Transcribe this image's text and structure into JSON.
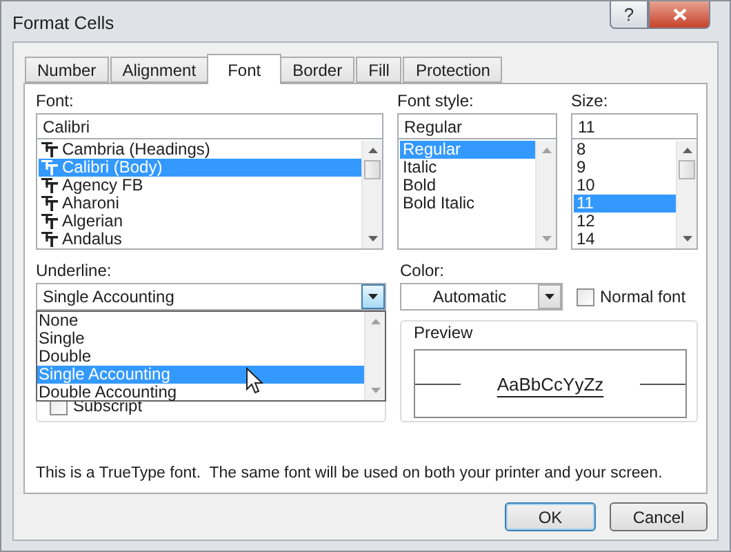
{
  "window": {
    "title": "Format Cells"
  },
  "title_buttons": [
    {
      "kind": "help",
      "label": "?"
    },
    {
      "kind": "close"
    }
  ],
  "tabs": [
    {
      "label": "Number",
      "selected": false
    },
    {
      "label": "Alignment",
      "selected": false
    },
    {
      "label": "Font",
      "selected": true
    },
    {
      "label": "Border",
      "selected": false
    },
    {
      "label": "Fill",
      "selected": false
    },
    {
      "label": "Protection",
      "selected": false
    }
  ],
  "font": {
    "label": "Font:",
    "value": "Calibri",
    "items": [
      {
        "name": "Cambria (Headings)",
        "selected": false
      },
      {
        "name": "Calibri (Body)",
        "selected": true
      },
      {
        "name": "Agency FB",
        "selected": false
      },
      {
        "name": "Aharoni",
        "selected": false
      },
      {
        "name": "Algerian",
        "selected": false
      },
      {
        "name": "Andalus",
        "selected": false
      }
    ]
  },
  "font_style": {
    "label": "Font style:",
    "value": "Regular",
    "items": [
      {
        "name": "Regular",
        "selected": true
      },
      {
        "name": "Italic",
        "selected": false
      },
      {
        "name": "Bold",
        "selected": false
      },
      {
        "name": "Bold Italic",
        "selected": false
      }
    ]
  },
  "size": {
    "label": "Size:",
    "value": "11",
    "items": [
      {
        "name": "8",
        "selected": false
      },
      {
        "name": "9",
        "selected": false
      },
      {
        "name": "10",
        "selected": false
      },
      {
        "name": "11",
        "selected": true
      },
      {
        "name": "12",
        "selected": false
      },
      {
        "name": "14",
        "selected": false
      }
    ]
  },
  "underline": {
    "label": "Underline:",
    "value": "Single Accounting",
    "expanded": true,
    "options": [
      {
        "label": "None",
        "selected": false
      },
      {
        "label": "Single",
        "selected": false
      },
      {
        "label": "Double",
        "selected": false
      },
      {
        "label": "Single Accounting",
        "selected": true
      },
      {
        "label": "Double Accounting",
        "selected": false
      }
    ]
  },
  "effects": {
    "subscript": {
      "label": "Subscript",
      "checked": false
    }
  },
  "color": {
    "label": "Color:",
    "value": "Automatic"
  },
  "normal_font": {
    "label": "Normal font",
    "checked": false
  },
  "preview": {
    "label": "Preview",
    "sample": "AaBbCcYyZz"
  },
  "message": "This is a TrueType font.  The same font will be used on both your printer and your screen.",
  "buttons": [
    {
      "label": "OK",
      "default": true
    },
    {
      "label": "Cancel",
      "default": false
    }
  ]
}
